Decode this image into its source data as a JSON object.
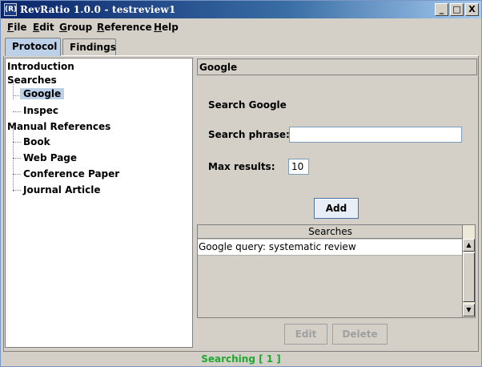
{
  "window": {
    "app_icon_text": "(R)",
    "title": "RevRatio 1.0.0 - testreview1",
    "minimize_glyph": "_",
    "maximize_glyph": "□",
    "close_glyph": "X"
  },
  "menubar": {
    "items": [
      {
        "mnemonic": "F",
        "rest": "ile"
      },
      {
        "mnemonic": "E",
        "rest": "dit"
      },
      {
        "mnemonic": "G",
        "rest": "roup"
      },
      {
        "mnemonic": "R",
        "rest": "eference"
      },
      {
        "mnemonic": "H",
        "rest": "elp"
      }
    ]
  },
  "tabs": [
    {
      "label": "Protocol",
      "active": true
    },
    {
      "label": "Findings",
      "active": false
    }
  ],
  "tree": {
    "introduction": "Introduction",
    "searches": "Searches",
    "google": "Google",
    "inspec": "Inspec",
    "manual_references": "Manual References",
    "book": "Book",
    "web_page": "Web Page",
    "conference_paper": "Conference Paper",
    "journal_article": "Journal Article"
  },
  "panel": {
    "header": "Google",
    "section_title": "Search Google",
    "search_phrase_label": "Search phrase:",
    "search_phrase_value": "",
    "max_results_label": "Max results:",
    "max_results_value": "10",
    "add_button": "Add"
  },
  "searches_table": {
    "header": "Searches",
    "rows": [
      "Google query: systematic review"
    ],
    "scroll_up_glyph": "▲",
    "scroll_down_glyph": "▼"
  },
  "actions": {
    "edit": "Edit",
    "delete": "Delete"
  },
  "status": {
    "text": "Searching [ 1 ]",
    "color": "#1fa830"
  },
  "colors": {
    "selection": "#bcd0e8",
    "titlebar_start": "#0a246a",
    "titlebar_end": "#a6caf0"
  }
}
